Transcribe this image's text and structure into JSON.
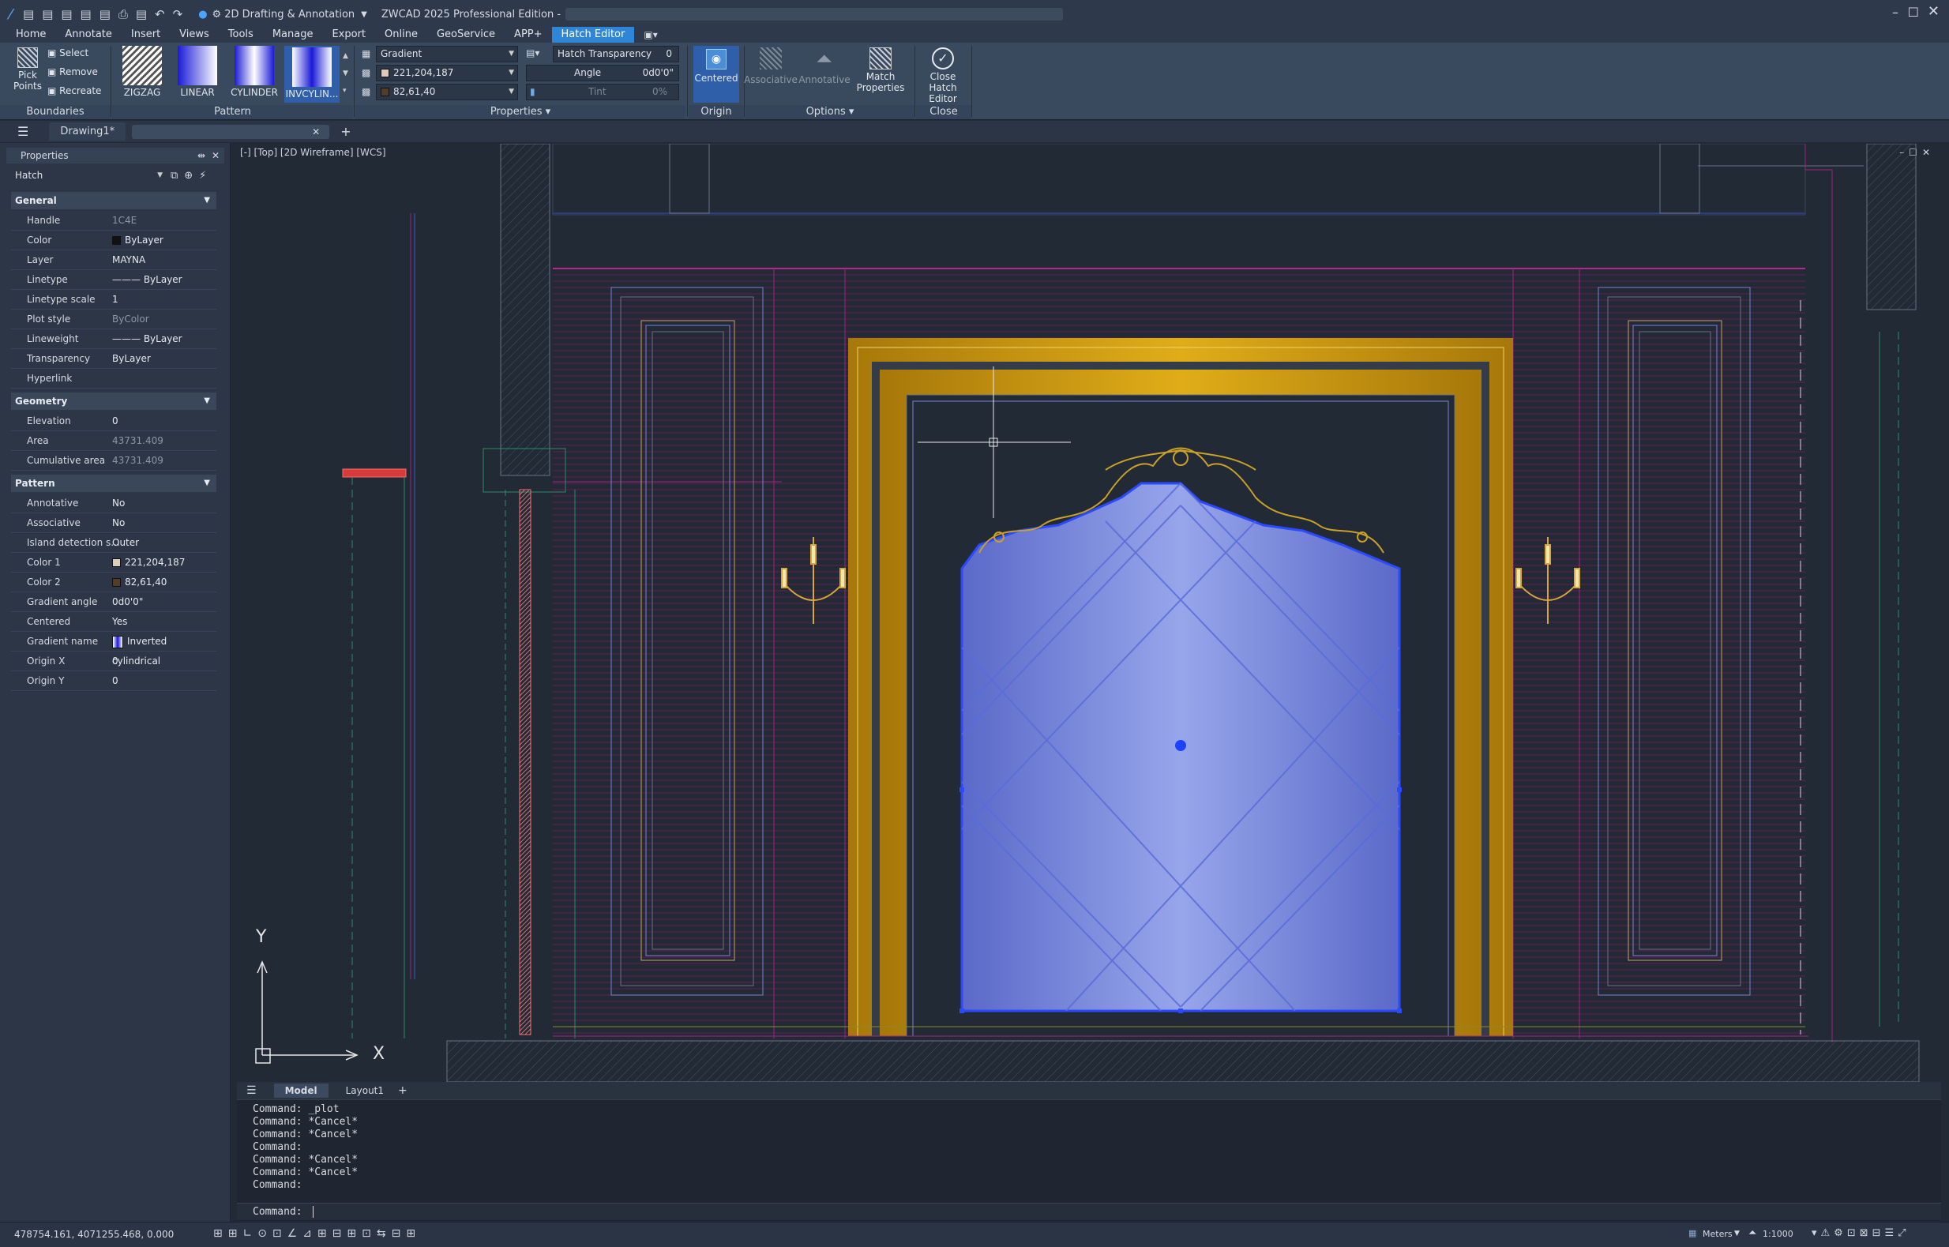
{
  "app": {
    "workspace": "2D Drafting & Annotation",
    "title": "ZWCAD 2025 Professional Edition -"
  },
  "menus": [
    "Home",
    "Annotate",
    "Insert",
    "Views",
    "Tools",
    "Manage",
    "Export",
    "Online",
    "GeoService",
    "APP+",
    "Hatch Editor"
  ],
  "ribbon": {
    "boundaries": {
      "label": "Boundaries",
      "pick": "Pick Points",
      "select": "Select",
      "remove": "Remove",
      "recreate": "Recreate"
    },
    "pattern": {
      "label": "Pattern",
      "items": [
        "ZIGZAG",
        "LINEAR",
        "CYLINDER",
        "INVCYLIN..."
      ]
    },
    "properties": {
      "label": "Properties",
      "type": "Gradient",
      "color1": "221,204,187",
      "color2": "82,61,40",
      "transparency_label": "Hatch Transparency",
      "transparency": "0",
      "angle_label": "Angle",
      "angle": "0d0'0\"",
      "tint_label": "Tint",
      "tint": "0%"
    },
    "origin": {
      "label": "Origin",
      "centered": "Centered"
    },
    "options": {
      "label": "Options",
      "associative": "Associative",
      "annotative": "Annotative",
      "match": "Match Properties"
    },
    "close": {
      "label": "Close",
      "close_btn": "Close Hatch Editor"
    }
  },
  "doc_tabs": [
    "Drawing1*"
  ],
  "props": {
    "title": "Properties",
    "selector": "Hatch",
    "general": "General",
    "geometry": "Geometry",
    "pattern": "Pattern",
    "rows_general": [
      [
        "Handle",
        "1C4E"
      ],
      [
        "Color",
        "ByLayer"
      ],
      [
        "Layer",
        "MAYNA"
      ],
      [
        "Linetype",
        "——— ByLayer"
      ],
      [
        "Linetype scale",
        "1"
      ],
      [
        "Plot style",
        "ByColor"
      ],
      [
        "Lineweight",
        "——— ByLayer"
      ],
      [
        "Transparency",
        "ByLayer"
      ],
      [
        "Hyperlink",
        ""
      ]
    ],
    "rows_geometry": [
      [
        "Elevation",
        "0"
      ],
      [
        "Area",
        "43731.409"
      ],
      [
        "Cumulative area",
        "43731.409"
      ]
    ],
    "rows_pattern": [
      [
        "Annotative",
        "No"
      ],
      [
        "Associative",
        "No"
      ],
      [
        "Island detection s...",
        "Outer"
      ],
      [
        "Color 1",
        "221,204,187"
      ],
      [
        "Color 2",
        "82,61,40"
      ],
      [
        "Gradient angle",
        "0d0'0\""
      ],
      [
        "Centered",
        "Yes"
      ],
      [
        "Gradient name",
        "Inverted cylindrical"
      ],
      [
        "Origin X",
        "0"
      ],
      [
        "Origin Y",
        "0"
      ]
    ]
  },
  "viewport": {
    "label": "[-] [Top] [2D Wireframe] [WCS]",
    "axis_x": "X",
    "axis_y": "Y"
  },
  "layout_tabs": [
    "Model",
    "Layout1"
  ],
  "commands": [
    "Command: _plot",
    "Command: *Cancel*",
    "Command: *Cancel*",
    "Command:",
    "Command: *Cancel*",
    "Command: *Cancel*",
    "Command:"
  ],
  "prompt": "Command:",
  "status": {
    "coords": "478754.161, 4071255.468, 0.000",
    "units": "Meters",
    "scale": "1:1000"
  },
  "colors": {
    "accent": "#2f86d6",
    "gold": "#c8960a",
    "hatch": "#8f9fe6",
    "magenta": "#8a1f6e"
  }
}
